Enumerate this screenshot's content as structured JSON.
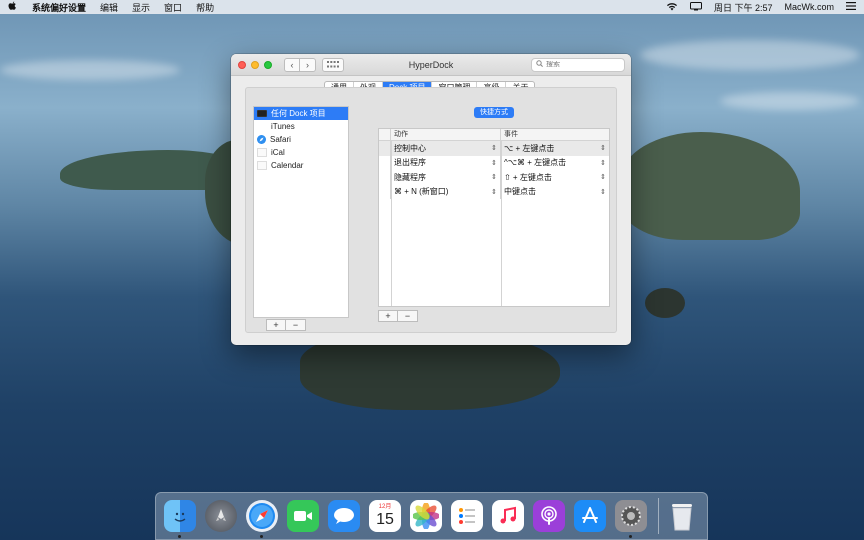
{
  "menubar": {
    "app_name": "系统偏好设置",
    "items": [
      "编辑",
      "显示",
      "窗口",
      "帮助"
    ],
    "clock": "周日 下午 2:57",
    "site": "MacWk.com"
  },
  "window": {
    "title": "HyperDock",
    "search_placeholder": "搜索",
    "back": "‹",
    "forward": "›",
    "tabs": [
      "通用",
      "外观",
      "Dock 项目",
      "窗口管理",
      "高级",
      "关于"
    ],
    "active_tab": "Dock 项目",
    "source_list": [
      "任何 Dock 项目",
      "iTunes",
      "Safari",
      "iCal",
      "Calendar"
    ],
    "shortcut_button": "快捷方式",
    "table": {
      "col_action": "动作",
      "col_event": "事件",
      "rows": [
        {
          "action": "控制中心",
          "event": "⌥ + 左键点击"
        },
        {
          "action": "退出程序",
          "event": "^⌥⌘ + 左键点击"
        },
        {
          "action": "隐藏程序",
          "event": "⇧ + 左键点击"
        },
        {
          "action": "⌘ + N (新窗口)",
          "event": "中键点击"
        }
      ]
    },
    "add": "+",
    "remove": "−"
  },
  "dock": {
    "calendar_month": "12月",
    "calendar_day": "15"
  },
  "colors": {
    "accent": "#2d7cf6"
  }
}
